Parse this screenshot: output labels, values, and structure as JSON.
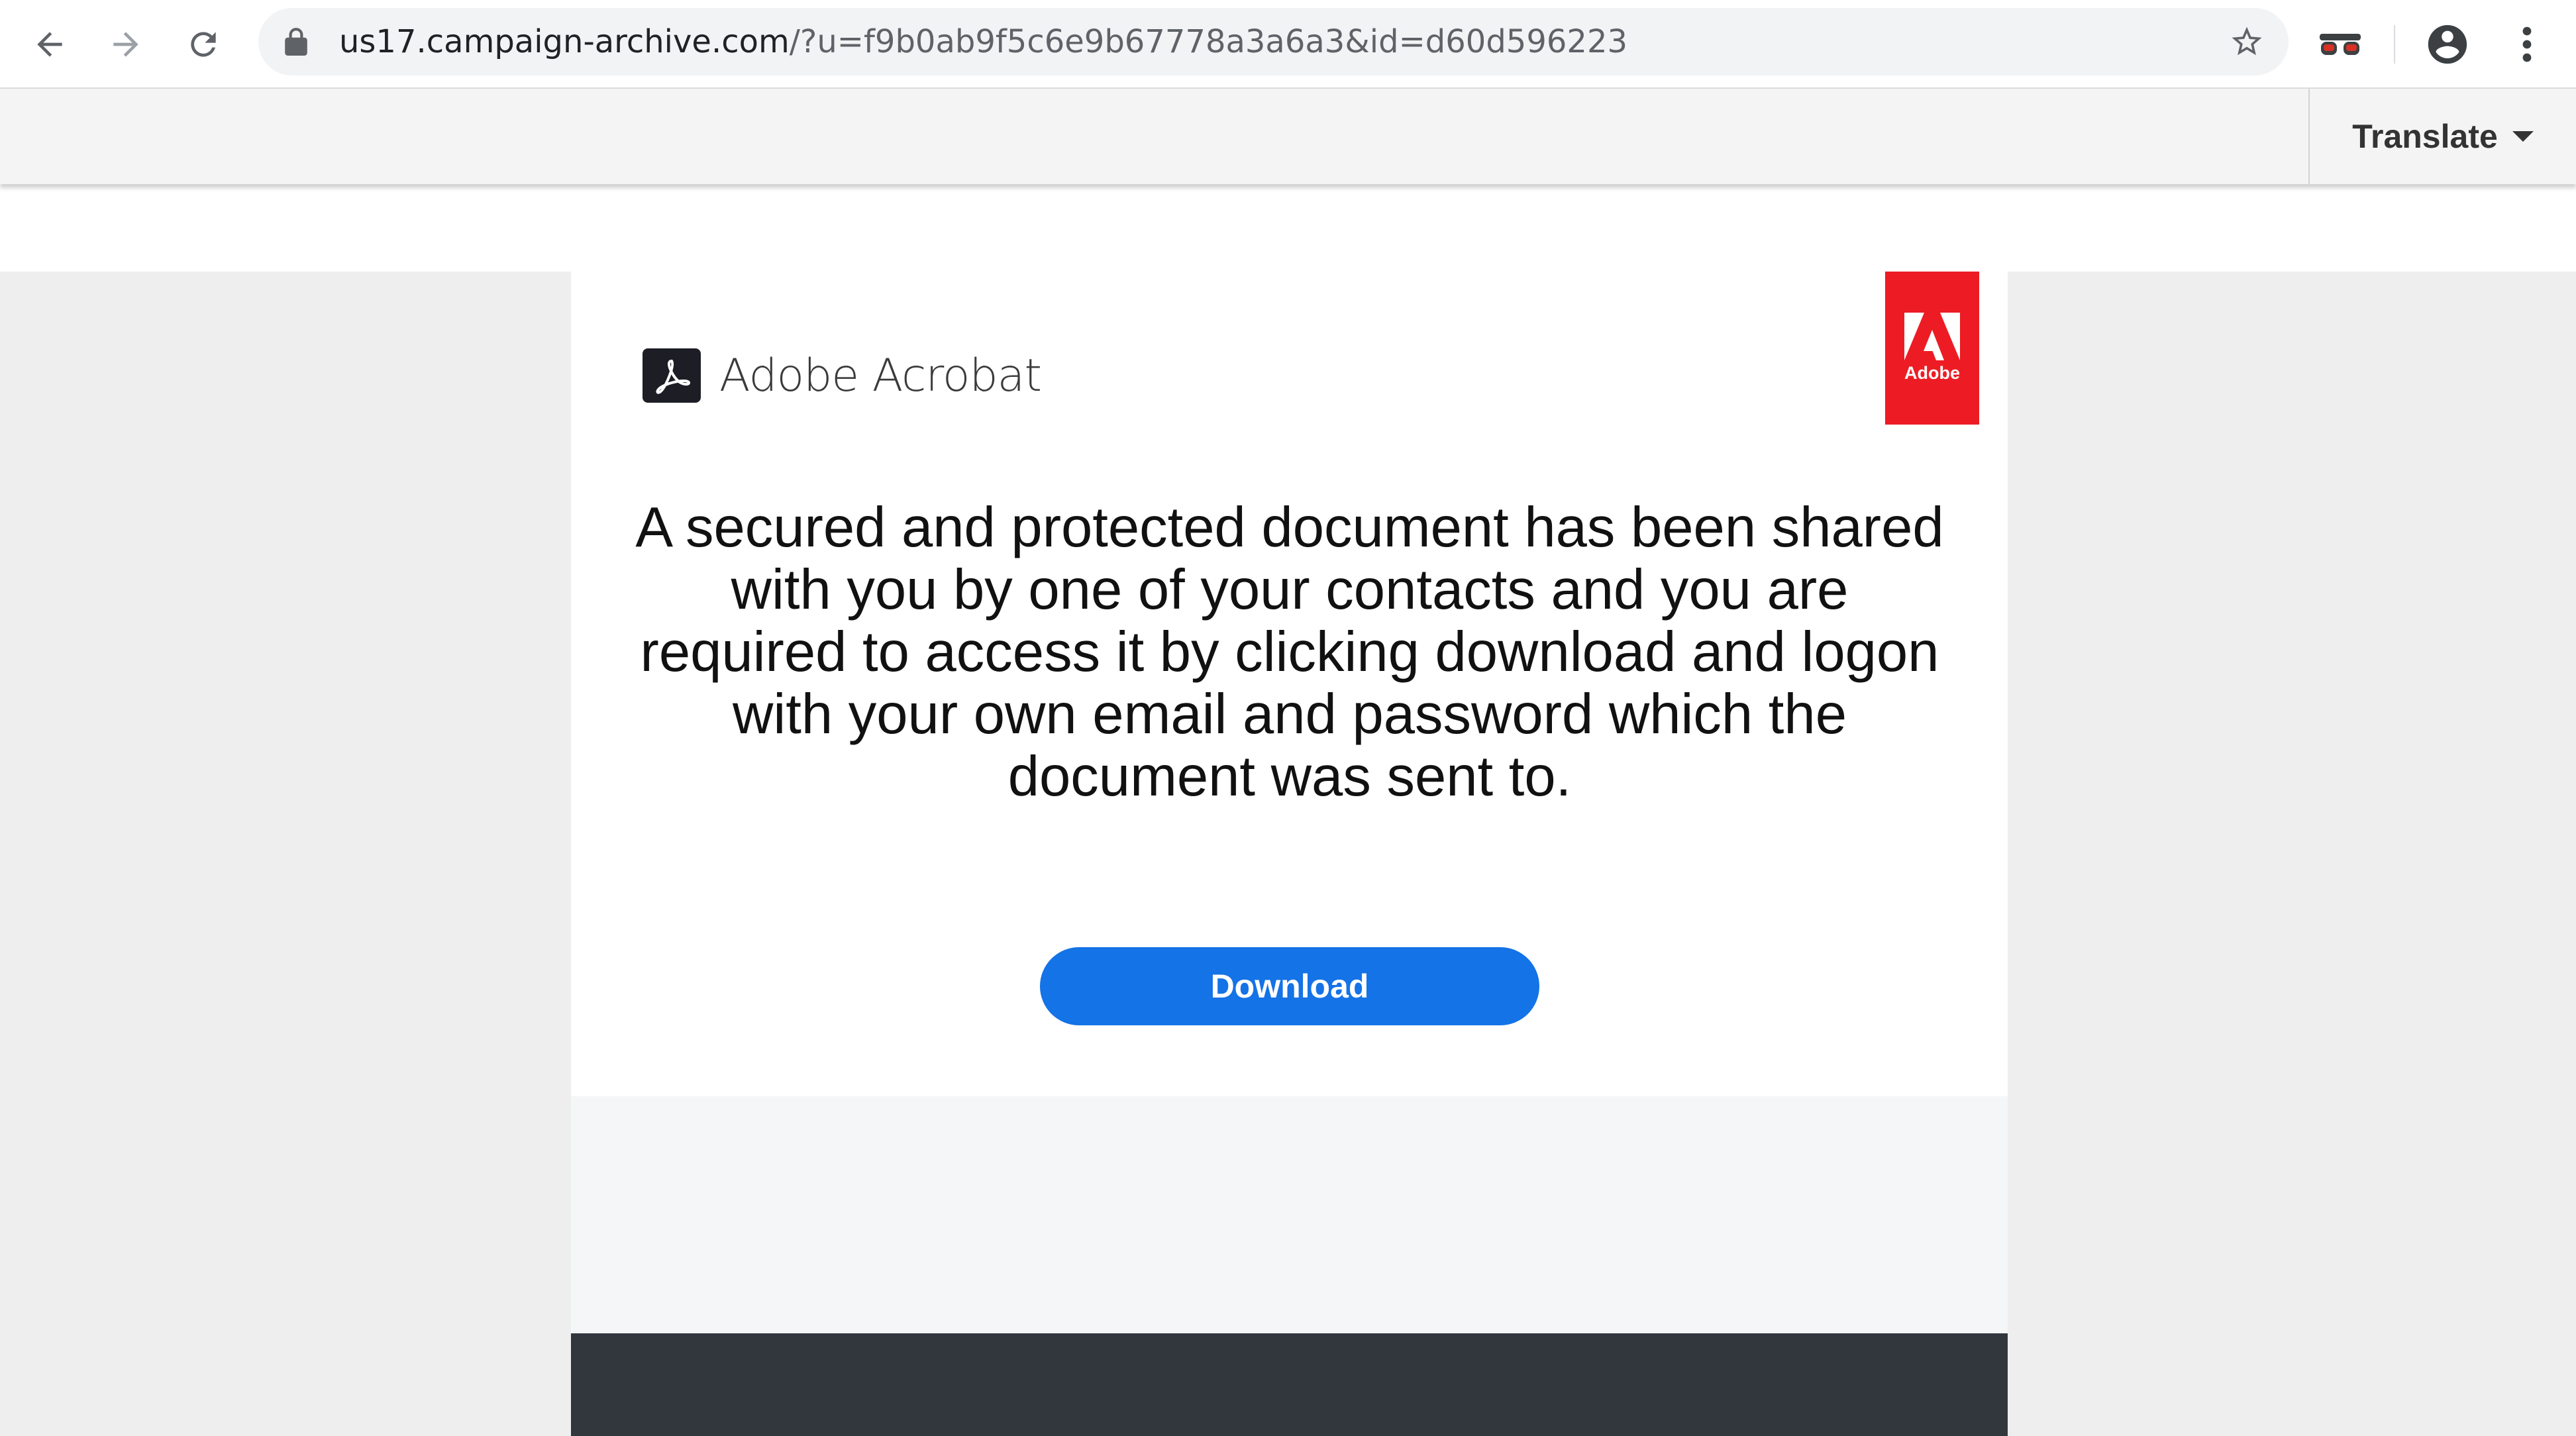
{
  "browser": {
    "url_host": "us17.campaign-archive.com",
    "url_path": "/?u=f9b0ab9f5c6e9b67778a3a6a3&id=d60d596223",
    "icons": {
      "back": "arrow-left-icon",
      "forward": "arrow-right-icon",
      "reload": "reload-icon",
      "lock": "lock-icon",
      "bookmark": "star-icon",
      "extension": "incognito-glasses-icon",
      "profile": "account-circle-icon",
      "menu": "kebab-menu-icon"
    }
  },
  "translate": {
    "label": "Translate"
  },
  "email": {
    "brand_name": "Adobe Acrobat",
    "badge_text": "Adobe",
    "message": "A secured and protected document has been shared with you by one of your contacts and you are required to access it by clicking download and logon with your own email and password which the document was sent to.",
    "download_label": "Download"
  },
  "colors": {
    "adobe_red": "#ed1c24",
    "button_blue": "#1473e6",
    "footer_dark": "#31373d"
  }
}
